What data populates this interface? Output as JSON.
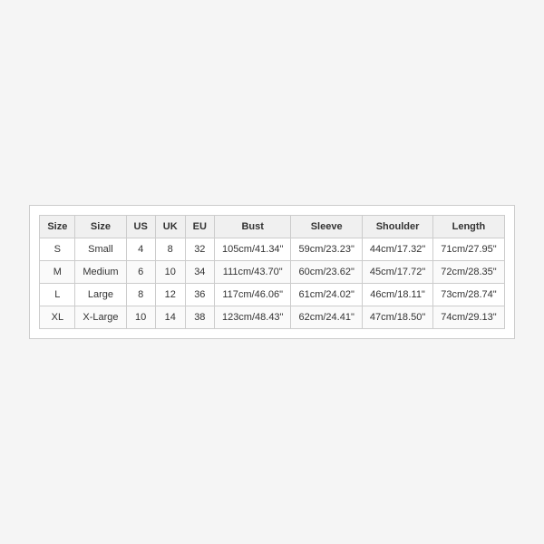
{
  "table": {
    "headers": [
      "Size",
      "Size",
      "US",
      "UK",
      "EU",
      "Bust",
      "Sleeve",
      "Shoulder",
      "Length"
    ],
    "rows": [
      {
        "size_code": "S",
        "size_name": "Small",
        "us": "4",
        "uk": "8",
        "eu": "32",
        "bust": "105cm/41.34\"",
        "sleeve": "59cm/23.23\"",
        "shoulder": "44cm/17.32\"",
        "length": "71cm/27.95\""
      },
      {
        "size_code": "M",
        "size_name": "Medium",
        "us": "6",
        "uk": "10",
        "eu": "34",
        "bust": "111cm/43.70\"",
        "sleeve": "60cm/23.62\"",
        "shoulder": "45cm/17.72\"",
        "length": "72cm/28.35\""
      },
      {
        "size_code": "L",
        "size_name": "Large",
        "us": "8",
        "uk": "12",
        "eu": "36",
        "bust": "117cm/46.06\"",
        "sleeve": "61cm/24.02\"",
        "shoulder": "46cm/18.11\"",
        "length": "73cm/28.74\""
      },
      {
        "size_code": "XL",
        "size_name": "X-Large",
        "us": "10",
        "uk": "14",
        "eu": "38",
        "bust": "123cm/48.43\"",
        "sleeve": "62cm/24.41\"",
        "shoulder": "47cm/18.50\"",
        "length": "74cm/29.13\""
      }
    ]
  }
}
